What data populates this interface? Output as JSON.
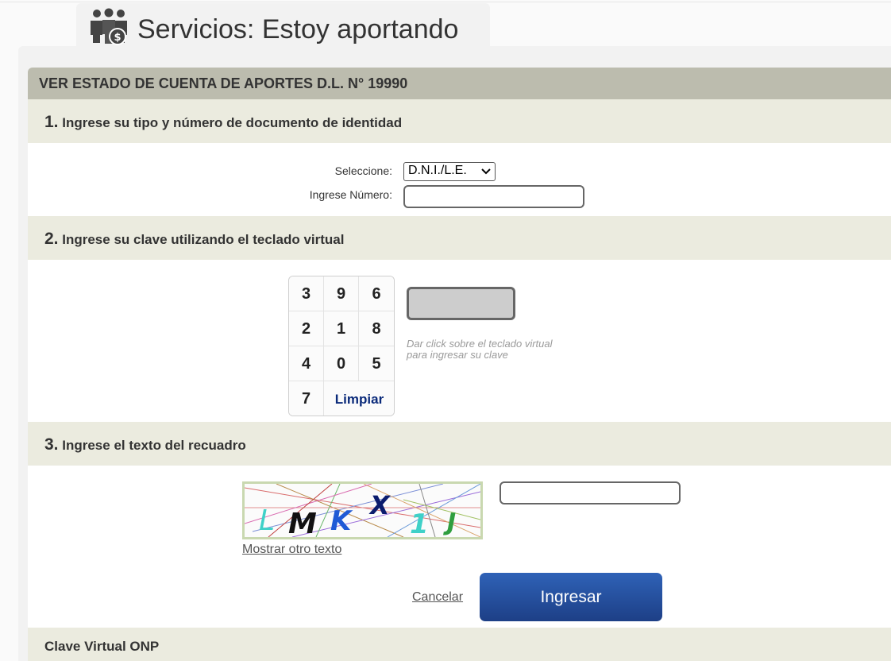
{
  "header": {
    "title": "Servicios: Estoy aportando",
    "icon": "people-money-icon"
  },
  "form": {
    "heading": "VER ESTADO DE CUENTA DE APORTES D.L. N° 19990",
    "step1": {
      "number": "1.",
      "title": "Ingrese su tipo y número de documento de identidad",
      "select_label": "Seleccione:",
      "select_value": "D.N.I./L.E.",
      "number_label": "Ingrese Número:",
      "number_value": ""
    },
    "step2": {
      "number": "2.",
      "title": "Ingrese su clave utilizando el teclado virtual",
      "keys": [
        "3",
        "9",
        "6",
        "2",
        "1",
        "8",
        "4",
        "0",
        "5",
        "7"
      ],
      "clear_label": "Limpiar",
      "hint_line1": "Dar click sobre el teclado virtual",
      "hint_line2": "para ingresar su clave"
    },
    "step3": {
      "number": "3.",
      "title": "Ingrese el texto del recuadro",
      "captcha_chars": [
        "L",
        "M",
        "K",
        "X",
        "1",
        "J"
      ],
      "refresh_link": "Mostrar otro texto",
      "captcha_value": ""
    },
    "actions": {
      "cancel": "Cancelar",
      "submit": "Ingresar"
    },
    "footer_title": "Clave Virtual ONP"
  },
  "colors": {
    "header_bar": "#bcbcae",
    "section_title": "#ebebdf",
    "submit_button": "#2548a0",
    "clear_key_text": "#0a2a7a"
  }
}
